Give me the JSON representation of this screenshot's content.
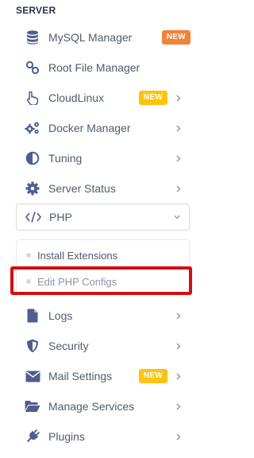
{
  "section": {
    "title": "SERVER"
  },
  "menu": {
    "mysql": {
      "label": "MySQL Manager",
      "badge": "NEW",
      "badge_color": "#f2813a"
    },
    "root_file": {
      "label": "Root File Manager"
    },
    "cloudlinux": {
      "label": "CloudLinux",
      "badge": "NEW",
      "badge_color": "#fcc312"
    },
    "docker": {
      "label": "Docker Manager"
    },
    "tuning": {
      "label": "Tuning"
    },
    "server_status": {
      "label": "Server Status"
    },
    "php": {
      "label": "PHP",
      "expanded": true,
      "submenu": [
        {
          "label": "Install Extensions"
        },
        {
          "label": "Edit PHP Configs"
        }
      ]
    },
    "logs": {
      "label": "Logs"
    },
    "security": {
      "label": "Security"
    },
    "mail": {
      "label": "Mail Settings",
      "badge": "NEW",
      "badge_color": "#fcc312"
    },
    "manage_services": {
      "label": "Manage Services"
    },
    "plugins": {
      "label": "Plugins"
    }
  },
  "colors": {
    "icon": "#4f5d8f",
    "text": "#4e5b6e",
    "highlight": "#d60d10"
  }
}
